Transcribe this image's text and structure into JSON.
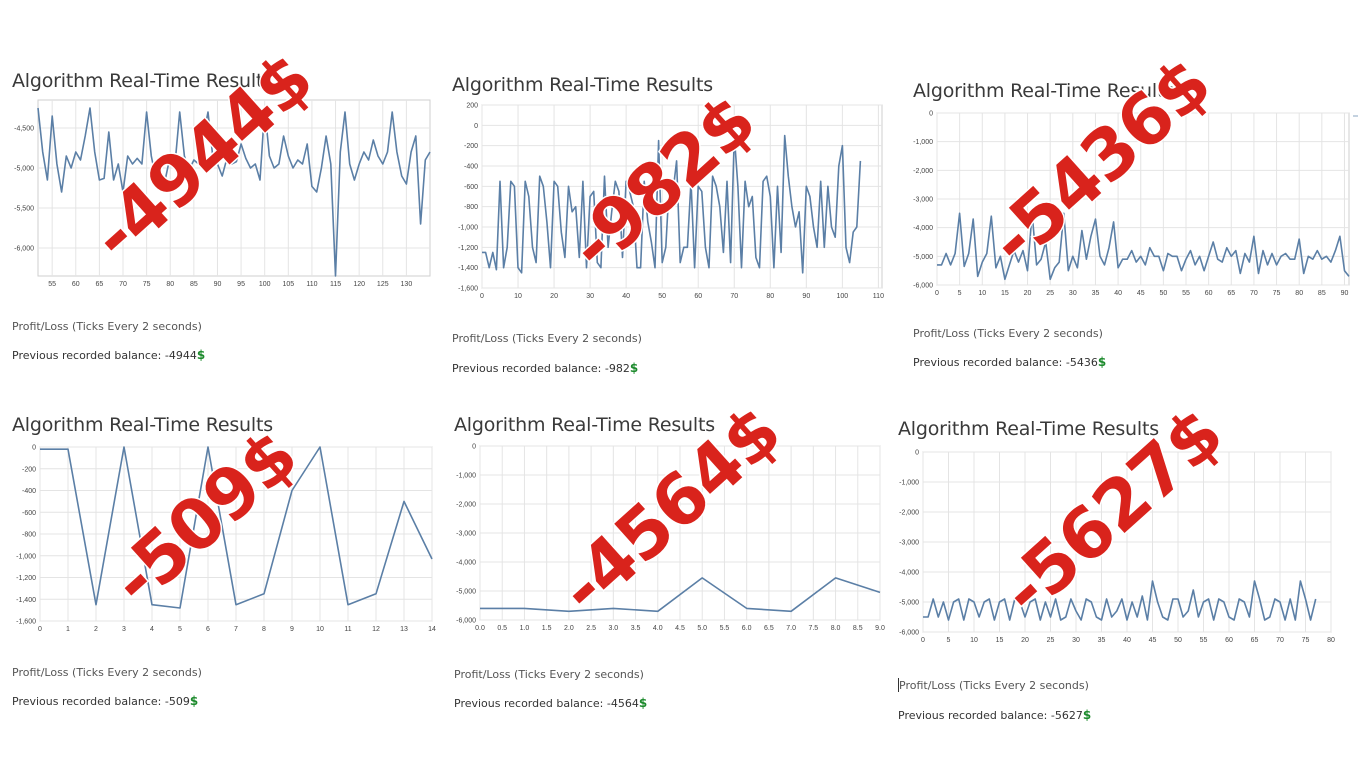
{
  "panels": [
    {
      "title": "Algorithm Real-Time Results",
      "caption": "Profit/Loss (Ticks Every 2 seconds)",
      "balance_label": "Previous recorded balance: ",
      "balance_value": "-4944",
      "stamp": "-4944$"
    },
    {
      "title": "Algorithm Real-Time Results",
      "caption": "Profit/Loss (Ticks Every 2 seconds)",
      "balance_label": "Previous recorded balance: ",
      "balance_value": "-982",
      "stamp": "-982$"
    },
    {
      "title": "Algorithm Real-Time Results",
      "caption": "Profit/Loss (Ticks Every 2 seconds)",
      "balance_label": "Previous recorded balance: ",
      "balance_value": "-5436",
      "stamp": "-5436$"
    },
    {
      "title": "Algorithm Real-Time Results",
      "caption": "Profit/Loss (Ticks Every 2 seconds)",
      "balance_label": "Previous recorded balance: ",
      "balance_value": "-509",
      "stamp": "-509$"
    },
    {
      "title": "Algorithm Real-Time Results",
      "caption": "Profit/Loss (Ticks Every 2 seconds)",
      "balance_label": "Previous recorded balance: ",
      "balance_value": "-4564",
      "stamp": "-4564$"
    },
    {
      "title": "Algorithm Real-Time Results",
      "caption": "Profit/Loss (Ticks Every 2 seconds)",
      "balance_label": "Previous recorded balance: ",
      "balance_value": "-5627",
      "stamp": "-5627$"
    }
  ],
  "dollar_icon": "heavy-dollar-sign-icon",
  "colors": {
    "line": "#5b7fa6",
    "grid": "#e4e4e4",
    "stamp": "#d9231c",
    "dollar": "#1c8a2c"
  },
  "chart_data": [
    {
      "type": "line",
      "xticks": [
        "55",
        "60",
        "65",
        "70",
        "75",
        "80",
        "85",
        "90",
        "95",
        "100",
        "105",
        "110",
        "115",
        "120",
        "125",
        "130"
      ],
      "yticks": [
        "-4,500",
        "-5,000",
        "-5,500",
        "-6,000"
      ],
      "xlim": [
        52,
        135
      ],
      "ylim": [
        -6350,
        -4150
      ],
      "x": [
        52,
        53,
        54,
        55,
        56,
        57,
        58,
        59,
        60,
        61,
        62,
        63,
        64,
        65,
        66,
        67,
        68,
        69,
        70,
        71,
        72,
        73,
        74,
        75,
        76,
        77,
        78,
        79,
        80,
        81,
        82,
        83,
        84,
        85,
        86,
        87,
        88,
        89,
        90,
        91,
        92,
        93,
        94,
        95,
        96,
        97,
        98,
        99,
        100,
        101,
        102,
        103,
        104,
        105,
        106,
        107,
        108,
        109,
        110,
        111,
        112,
        113,
        114,
        115,
        116,
        117,
        118,
        119,
        120,
        121,
        122,
        123,
        124,
        125,
        126,
        127,
        128,
        129,
        130,
        131,
        132,
        133,
        134,
        135
      ],
      "y": [
        -4250,
        -4800,
        -5150,
        -4350,
        -4950,
        -5300,
        -4850,
        -5000,
        -4800,
        -4900,
        -4600,
        -4250,
        -4800,
        -5150,
        -5130,
        -4550,
        -5150,
        -4950,
        -5300,
        -4850,
        -4950,
        -4880,
        -4950,
        -4300,
        -4850,
        -5150,
        -5230,
        -5130,
        -4850,
        -4950,
        -4300,
        -4850,
        -5020,
        -4900,
        -4950,
        -4600,
        -4300,
        -4850,
        -4950,
        -5100,
        -4880,
        -4950,
        -4920,
        -4700,
        -4880,
        -5000,
        -4950,
        -5150,
        -4250,
        -4850,
        -5000,
        -4950,
        -4600,
        -4850,
        -5000,
        -4900,
        -4950,
        -4700,
        -5230,
        -5300,
        -5000,
        -4600,
        -4950,
        -6350,
        -4800,
        -4300,
        -4950,
        -5150,
        -4950,
        -4800,
        -4900,
        -4650,
        -4850,
        -4950,
        -4800,
        -4300,
        -4800,
        -5100,
        -5200,
        -4800,
        -4600,
        -5700,
        -4900,
        -4800
      ]
    },
    {
      "type": "line",
      "xticks": [
        "0",
        "10",
        "20",
        "30",
        "40",
        "50",
        "60",
        "70",
        "80",
        "90",
        "100",
        "110"
      ],
      "yticks": [
        "200",
        "0",
        "-200",
        "-400",
        "-600",
        "-800",
        "-1,000",
        "-1,200",
        "-1,400",
        "-1,600"
      ],
      "xlim": [
        0,
        111
      ],
      "ylim": [
        -1600,
        200
      ],
      "x": [
        0,
        1,
        2,
        3,
        4,
        5,
        6,
        7,
        8,
        9,
        10,
        11,
        12,
        13,
        14,
        15,
        16,
        17,
        18,
        19,
        20,
        21,
        22,
        23,
        24,
        25,
        26,
        27,
        28,
        29,
        30,
        31,
        32,
        33,
        34,
        35,
        36,
        37,
        38,
        39,
        40,
        41,
        42,
        43,
        44,
        45,
        46,
        47,
        48,
        49,
        50,
        51,
        52,
        53,
        54,
        55,
        56,
        57,
        58,
        59,
        60,
        61,
        62,
        63,
        64,
        65,
        66,
        67,
        68,
        69,
        70,
        71,
        72,
        73,
        74,
        75,
        76,
        77,
        78,
        79,
        80,
        81,
        82,
        83,
        84,
        85,
        86,
        87,
        88,
        89,
        90,
        91,
        92,
        93,
        94,
        95,
        96,
        97,
        98,
        99,
        100,
        101,
        102,
        103,
        104,
        105
      ],
      "y": [
        -1250,
        -1250,
        -1400,
        -1250,
        -1420,
        -550,
        -1400,
        -1200,
        -550,
        -600,
        -1400,
        -1450,
        -550,
        -700,
        -1200,
        -1350,
        -500,
        -600,
        -950,
        -1400,
        -550,
        -600,
        -1050,
        -1300,
        -600,
        -850,
        -800,
        -1300,
        -550,
        -1400,
        -700,
        -650,
        -1350,
        -1400,
        -500,
        -1200,
        -850,
        -550,
        -650,
        -1300,
        -550,
        -650,
        -800,
        -1400,
        -1400,
        -550,
        -950,
        -1150,
        -1400,
        -150,
        -1350,
        -1200,
        -550,
        -650,
        -350,
        -1350,
        -1200,
        -1200,
        -550,
        -1400,
        -600,
        -650,
        -1200,
        -1400,
        -500,
        -600,
        -800,
        -1250,
        -550,
        -1350,
        -100,
        -600,
        -1400,
        -550,
        -800,
        -700,
        -1300,
        -1400,
        -550,
        -500,
        -700,
        -1400,
        -600,
        -1250,
        -100,
        -500,
        -800,
        -1000,
        -850,
        -1450,
        -600,
        -700,
        -1000,
        -1200,
        -550,
        -1200,
        -600,
        -1000,
        -1100,
        -400,
        -200,
        -1200,
        -1350,
        -1050,
        -1000,
        -350
      ]
    },
    {
      "type": "line",
      "xticks": [
        "0",
        "5",
        "10",
        "15",
        "20",
        "25",
        "30",
        "35",
        "40",
        "45",
        "50",
        "55",
        "60",
        "65",
        "70",
        "75",
        "80",
        "85",
        "90"
      ],
      "yticks": [
        "0",
        "-1,000",
        "-2,000",
        "-3,000",
        "-4,000",
        "-5,000",
        "-6,000"
      ],
      "xlim": [
        0,
        91
      ],
      "ylim": [
        -6000,
        0
      ],
      "x": [
        0,
        1,
        2,
        3,
        4,
        5,
        6,
        7,
        8,
        9,
        10,
        11,
        12,
        13,
        14,
        15,
        16,
        17,
        18,
        19,
        20,
        21,
        22,
        23,
        24,
        25,
        26,
        27,
        28,
        29,
        30,
        31,
        32,
        33,
        34,
        35,
        36,
        37,
        38,
        39,
        40,
        41,
        42,
        43,
        44,
        45,
        46,
        47,
        48,
        49,
        50,
        51,
        52,
        53,
        54,
        55,
        56,
        57,
        58,
        59,
        60,
        61,
        62,
        63,
        64,
        65,
        66,
        67,
        68,
        69,
        70,
        71,
        72,
        73,
        74,
        75,
        76,
        77,
        78,
        79,
        80,
        81,
        82,
        83,
        84,
        85,
        86,
        87,
        88,
        89,
        90,
        91
      ],
      "y": [
        -5300,
        -5300,
        -4900,
        -5300,
        -4900,
        -3500,
        -5350,
        -4900,
        -3700,
        -5700,
        -5200,
        -4900,
        -3600,
        -5400,
        -5000,
        -5800,
        -5300,
        -4800,
        -5200,
        -4800,
        -5500,
        -3500,
        -5300,
        -5100,
        -4500,
        -5800,
        -5400,
        -5200,
        -3500,
        -5500,
        -5000,
        -5400,
        -4100,
        -5100,
        -4300,
        -3700,
        -5000,
        -5300,
        -4700,
        -3800,
        -5400,
        -5100,
        -5100,
        -4800,
        -5200,
        -5000,
        -5300,
        -4700,
        -5000,
        -5000,
        -5500,
        -4900,
        -5000,
        -5000,
        -5500,
        -5100,
        -4800,
        -5300,
        -5000,
        -5500,
        -5000,
        -4500,
        -5100,
        -5200,
        -4700,
        -5000,
        -4800,
        -5600,
        -4900,
        -5200,
        -4300,
        -5600,
        -4800,
        -5300,
        -4900,
        -5300,
        -5000,
        -4900,
        -5100,
        -5100,
        -4400,
        -5600,
        -5000,
        -5100,
        -4800,
        -5100,
        -5000,
        -5200,
        -4800,
        -4300,
        -5500,
        -5700
      ]
    },
    {
      "type": "line",
      "xticks": [
        "0",
        "1",
        "2",
        "3",
        "4",
        "5",
        "6",
        "7",
        "8",
        "9",
        "10",
        "11",
        "12",
        "13",
        "14"
      ],
      "yticks": [
        "0",
        "-200",
        "-400",
        "-600",
        "-800",
        "-1,000",
        "-1,200",
        "-1,400",
        "-1,600"
      ],
      "xlim": [
        0,
        14
      ],
      "ylim": [
        -1600,
        0
      ],
      "x": [
        0,
        1,
        2,
        3,
        4,
        5,
        6,
        7,
        8,
        9,
        10,
        11,
        12,
        13,
        14
      ],
      "y": [
        -20,
        -20,
        -1450,
        0,
        -1450,
        -1480,
        0,
        -1450,
        -1350,
        -400,
        0,
        -1450,
        -1350,
        -500,
        -1030
      ]
    },
    {
      "type": "line",
      "xticks": [
        "0.0",
        "0.5",
        "1.0",
        "1.5",
        "2.0",
        "2.5",
        "3.0",
        "3.5",
        "4.0",
        "4.5",
        "5.0",
        "5.5",
        "6.0",
        "6.5",
        "7.0",
        "7.5",
        "8.0",
        "8.5",
        "9.0"
      ],
      "yticks": [
        "0",
        "-1,000",
        "-2,000",
        "-3,000",
        "-4,000",
        "-5,000",
        "-6,000"
      ],
      "xlim": [
        0,
        9
      ],
      "ylim": [
        -6000,
        0
      ],
      "x": [
        0,
        1,
        2,
        3,
        4,
        5,
        6,
        7,
        8,
        9
      ],
      "y": [
        -5600,
        -5600,
        -5700,
        -5600,
        -5700,
        -4550,
        -5600,
        -5700,
        -4550,
        -5050
      ]
    },
    {
      "type": "line",
      "xticks": [
        "0",
        "5",
        "10",
        "15",
        "20",
        "25",
        "30",
        "35",
        "40",
        "45",
        "50",
        "55",
        "60",
        "65",
        "70",
        "75",
        "80"
      ],
      "yticks": [
        "0",
        "-1,000",
        "-2,000",
        "-3,000",
        "-4,000",
        "-5,000",
        "-6,000"
      ],
      "xlim": [
        0,
        80
      ],
      "ylim": [
        -6000,
        0
      ],
      "x": [
        0,
        1,
        2,
        3,
        4,
        5,
        6,
        7,
        8,
        9,
        10,
        11,
        12,
        13,
        14,
        15,
        16,
        17,
        18,
        19,
        20,
        21,
        22,
        23,
        24,
        25,
        26,
        27,
        28,
        29,
        30,
        31,
        32,
        33,
        34,
        35,
        36,
        37,
        38,
        39,
        40,
        41,
        42,
        43,
        44,
        45,
        46,
        47,
        48,
        49,
        50,
        51,
        52,
        53,
        54,
        55,
        56,
        57,
        58,
        59,
        60,
        61,
        62,
        63,
        64,
        65,
        66,
        67,
        68,
        69,
        70,
        71,
        72,
        73,
        74,
        75,
        76,
        77
      ],
      "y": [
        -5500,
        -5500,
        -4900,
        -5500,
        -5000,
        -5600,
        -5000,
        -4900,
        -5600,
        -4900,
        -5000,
        -5500,
        -5000,
        -4900,
        -5600,
        -5000,
        -4900,
        -5600,
        -4900,
        -5000,
        -5500,
        -5000,
        -4900,
        -5600,
        -5000,
        -5500,
        -4900,
        -5600,
        -5500,
        -4900,
        -5300,
        -5600,
        -4900,
        -5000,
        -5500,
        -5600,
        -4900,
        -5500,
        -5300,
        -4900,
        -5600,
        -5000,
        -5500,
        -4800,
        -5600,
        -4300,
        -5000,
        -5500,
        -5600,
        -4900,
        -4900,
        -5500,
        -5300,
        -4600,
        -5500,
        -5000,
        -4900,
        -5600,
        -4900,
        -5000,
        -5500,
        -5600,
        -4900,
        -5000,
        -5500,
        -4300,
        -4900,
        -5600,
        -5500,
        -4900,
        -5000,
        -5600,
        -4900,
        -5600,
        -4300,
        -4900,
        -5600,
        -4900
      ]
    }
  ]
}
